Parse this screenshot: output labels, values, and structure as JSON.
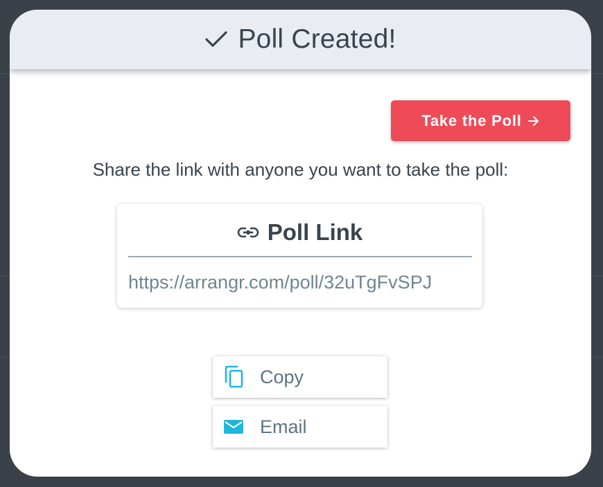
{
  "modal": {
    "header": {
      "title": "Poll Created!",
      "icon": "check-icon"
    },
    "take_poll_button": {
      "label": "Take the Poll",
      "icon": "arrow-right-icon",
      "color": "#ef4a57"
    },
    "share_instruction": "Share the link with anyone you want to take the poll:",
    "link_card": {
      "title": "Poll Link",
      "icon": "link-chain-icon",
      "url": "https://arrangr.com/poll/32uTgFvSPJ"
    },
    "actions": [
      {
        "label": "Copy",
        "icon": "copy-icon",
        "icon_color": "#1fb6de"
      },
      {
        "label": "Email",
        "icon": "envelope-icon",
        "icon_color": "#1fb6de"
      }
    ]
  },
  "colors": {
    "header_background": "#e9edf1",
    "text": "#39444e",
    "accent": "#1fb6de",
    "backdrop": "#3b4148"
  }
}
